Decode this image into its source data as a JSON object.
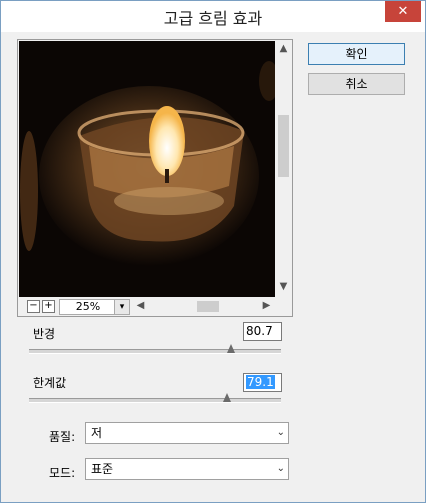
{
  "window": {
    "title": "고급 흐림 효과",
    "close_glyph": "✕"
  },
  "buttons": {
    "ok": "확인",
    "cancel": "취소"
  },
  "preview": {
    "zoom_out": "−",
    "zoom_in": "+",
    "zoom_value": "25%",
    "zoom_dropdown": "▾",
    "scroll_up": "▲",
    "scroll_down": "▼",
    "scroll_left": "◀",
    "scroll_right": "▶"
  },
  "radius": {
    "label": "반경",
    "value": "80.7",
    "slider_fraction": 0.79
  },
  "threshold": {
    "label": "한계값",
    "value": "79.1",
    "slider_fraction": 0.79
  },
  "quality": {
    "label": "품질:",
    "value": "저",
    "chevron": "⌄"
  },
  "mode": {
    "label": "모드:",
    "value": "표준",
    "chevron": "⌄"
  },
  "colors": {
    "accent": "#3c7fb1",
    "close": "#c7443a",
    "selection": "#3399ff"
  }
}
